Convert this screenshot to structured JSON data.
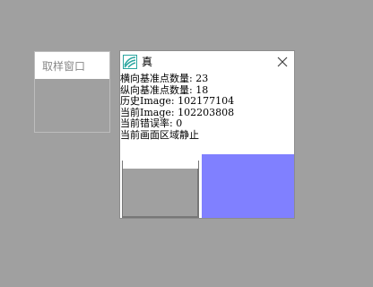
{
  "sample_window": {
    "title": "取样窗口"
  },
  "main_window": {
    "title": "真",
    "icon": "app-logo-icon",
    "close_icon": "close-icon",
    "info_lines": [
      "横向基准点数量: 23",
      "纵向基准点数量: 18",
      "历史Image: 102177104",
      "当前Image: 102203808",
      "当前错误率: 0",
      "当前画面区域静止"
    ],
    "preview": {
      "left_color": "#a0a0a0",
      "right_color": "#8080ff"
    }
  },
  "colors": {
    "desktop": "#a0a0a0",
    "icon_accent": "#2aa6a0",
    "preview_blue": "#8080ff"
  }
}
